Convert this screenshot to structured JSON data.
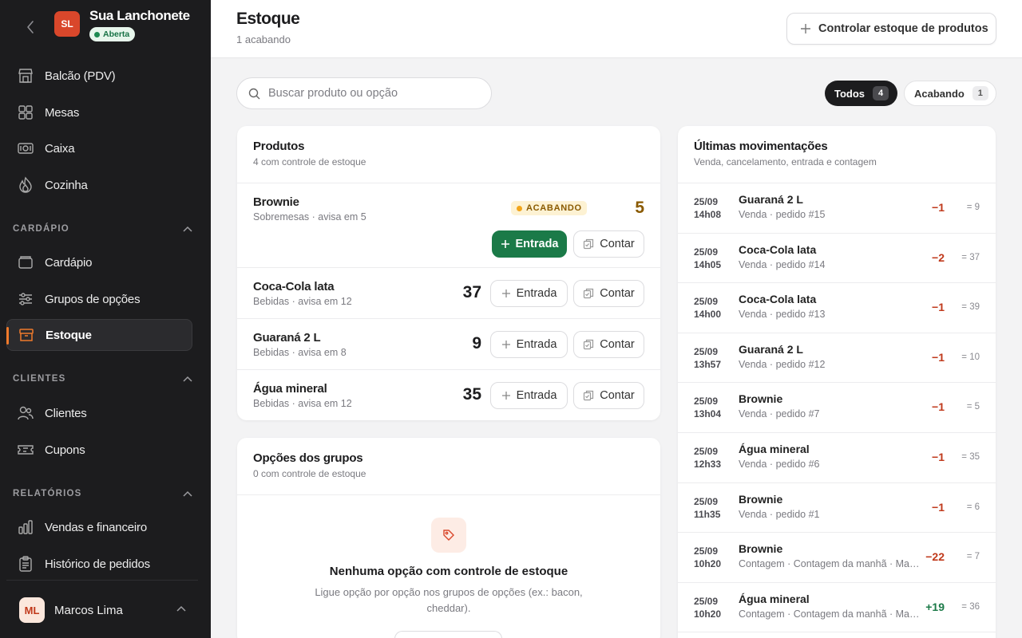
{
  "store": {
    "initials": "SL",
    "name": "Sua Lanchonete",
    "status": "Aberta"
  },
  "nav": {
    "main": [
      {
        "label": "Balcão (PDV)",
        "icon": "store-icon"
      },
      {
        "label": "Mesas",
        "icon": "grid-icon"
      },
      {
        "label": "Caixa",
        "icon": "cash-icon"
      },
      {
        "label": "Cozinha",
        "icon": "flame-icon"
      }
    ],
    "cardapio": {
      "title": "CARDÁPIO",
      "items": [
        {
          "label": "Cardápio",
          "icon": "menu-book-icon"
        },
        {
          "label": "Grupos de opções",
          "icon": "sliders-icon"
        },
        {
          "label": "Estoque",
          "icon": "box-icon",
          "active": true
        }
      ]
    },
    "clientes": {
      "title": "CLIENTES",
      "items": [
        {
          "label": "Clientes",
          "icon": "users-icon"
        },
        {
          "label": "Cupons",
          "icon": "ticket-icon"
        }
      ]
    },
    "relatorios": {
      "title": "RELATÓRIOS",
      "items": [
        {
          "label": "Vendas e financeiro",
          "icon": "bar-chart-icon"
        },
        {
          "label": "Histórico de pedidos",
          "icon": "clipboard-icon"
        }
      ]
    }
  },
  "user": {
    "initials": "ML",
    "name": "Marcos Lima"
  },
  "header": {
    "title": "Estoque",
    "subtitle": "1 acabando",
    "control_button": "Controlar estoque de produtos"
  },
  "search": {
    "placeholder": "Buscar produto ou opção",
    "value": ""
  },
  "filters": [
    {
      "label": "Todos",
      "count": "4",
      "active": true
    },
    {
      "label": "Acabando",
      "count": "1",
      "active": false
    }
  ],
  "products": {
    "title": "Produtos",
    "subtitle": "4 com controle de estoque",
    "entry_label": "Entrada",
    "count_label": "Contar",
    "low_badge": "ACABANDO",
    "colors": {
      "low_qty": "#8a5a00",
      "entry_green": "#1b7a48"
    },
    "items": [
      {
        "name": "Brownie",
        "meta": "Sobremesas · avisa em 5",
        "qty": "5",
        "low": true
      },
      {
        "name": "Coca-Cola lata",
        "meta": "Bebidas · avisa em 12",
        "qty": "37",
        "low": false
      },
      {
        "name": "Guaraná 2 L",
        "meta": "Bebidas · avisa em 8",
        "qty": "9",
        "low": false
      },
      {
        "name": "Água mineral",
        "meta": "Bebidas · avisa em 12",
        "qty": "35",
        "low": false
      }
    ]
  },
  "options": {
    "title": "Opções dos grupos",
    "subtitle": "0 com controle de estoque",
    "empty_title": "Nenhuma opção com controle de estoque",
    "empty_desc": "Ligue opção por opção nos grupos de opções (ex.: bacon, cheddar)."
  },
  "movements": {
    "title": "Últimas movimentações",
    "subtitle": "Venda, cancelamento, entrada e contagem",
    "colors": {
      "negative": "#c0391b",
      "positive": "#1b7a48"
    },
    "items": [
      {
        "date": "25/09",
        "time": "14h08",
        "name": "Guaraná 2 L",
        "desc": "Venda · pedido #15",
        "delta": "−1",
        "total": "= 9"
      },
      {
        "date": "25/09",
        "time": "14h05",
        "name": "Coca-Cola lata",
        "desc": "Venda · pedido #14",
        "delta": "−2",
        "total": "= 37"
      },
      {
        "date": "25/09",
        "time": "14h00",
        "name": "Coca-Cola lata",
        "desc": "Venda · pedido #13",
        "delta": "−1",
        "total": "= 39"
      },
      {
        "date": "25/09",
        "time": "13h57",
        "name": "Guaraná 2 L",
        "desc": "Venda · pedido #12",
        "delta": "−1",
        "total": "= 10"
      },
      {
        "date": "25/09",
        "time": "13h04",
        "name": "Brownie",
        "desc": "Venda · pedido #7",
        "delta": "−1",
        "total": "= 5"
      },
      {
        "date": "25/09",
        "time": "12h33",
        "name": "Água mineral",
        "desc": "Venda · pedido #6",
        "delta": "−1",
        "total": "= 35"
      },
      {
        "date": "25/09",
        "time": "11h35",
        "name": "Brownie",
        "desc": "Venda · pedido #1",
        "delta": "−1",
        "total": "= 6"
      },
      {
        "date": "25/09",
        "time": "10h20",
        "name": "Brownie",
        "desc": "Contagem · Contagem da manhã · Ma…",
        "delta": "−22",
        "total": "= 7"
      },
      {
        "date": "25/09",
        "time": "10h20",
        "name": "Água mineral",
        "desc": "Contagem · Contagem da manhã · Ma…",
        "delta": "+19",
        "total": "= 36"
      }
    ]
  }
}
